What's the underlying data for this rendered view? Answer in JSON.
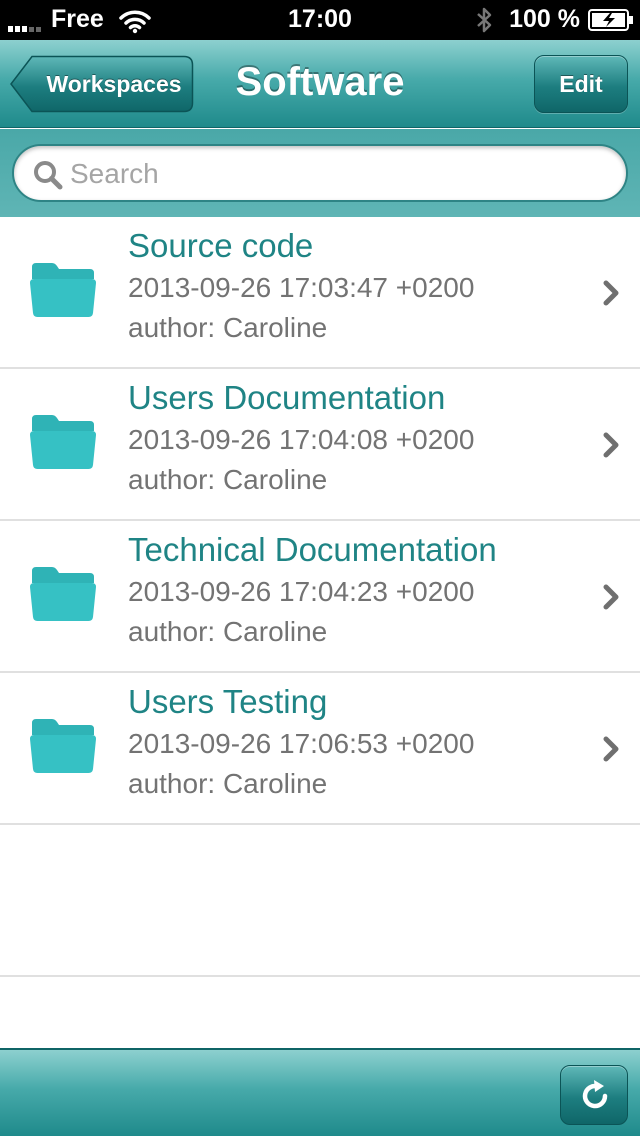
{
  "status_bar": {
    "carrier": "Free",
    "time": "17:00",
    "battery": "100 %"
  },
  "nav": {
    "back_label": "Workspaces",
    "title": "Software",
    "edit_label": "Edit"
  },
  "search": {
    "placeholder": "Search",
    "value": ""
  },
  "items": [
    {
      "title": "Source code",
      "date": "2013-09-26 17:03:47 +0200",
      "author": "author: Caroline"
    },
    {
      "title": "Users Documentation",
      "date": "2013-09-26 17:04:08 +0200",
      "author": "author: Caroline"
    },
    {
      "title": "Technical Documentation",
      "date": "2013-09-26 17:04:23 +0200",
      "author": "author: Caroline"
    },
    {
      "title": "Users Testing",
      "date": "2013-09-26 17:06:53 +0200",
      "author": "author: Caroline"
    }
  ],
  "icons": {
    "item": "folder-icon",
    "disclosure": "chevron-right-icon",
    "toolbar": "refresh-icon"
  },
  "colors": {
    "accent": "#2f9999",
    "title_text": "#1f8485",
    "secondary_text": "#737373"
  }
}
